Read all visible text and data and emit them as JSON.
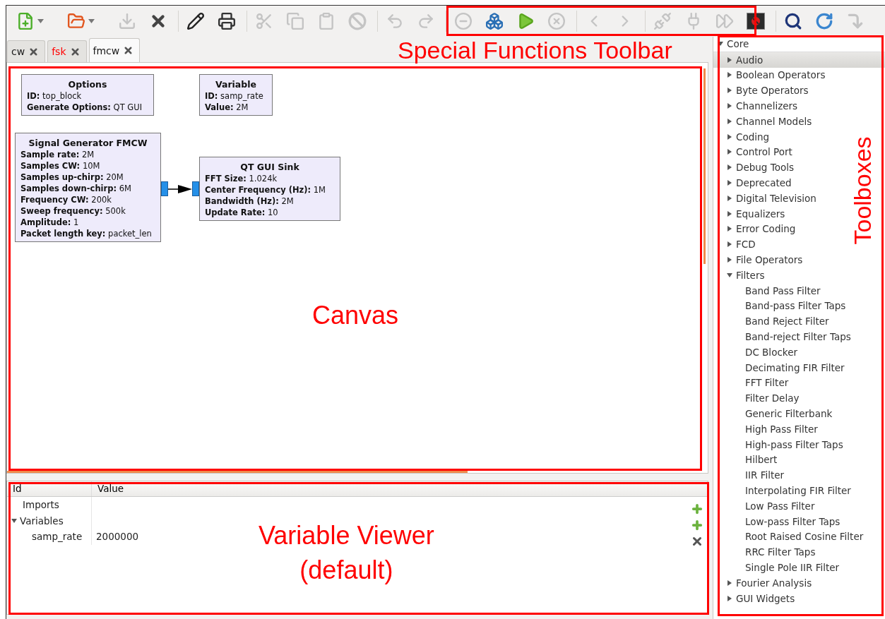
{
  "toolbar": [
    {
      "kind": "new",
      "disabled": false,
      "dropdown": true
    },
    {
      "kind": "open",
      "disabled": false,
      "dropdown": true
    },
    {
      "kind": "save",
      "disabled": true
    },
    {
      "kind": "close",
      "disabled": false
    },
    {
      "kind": "separator"
    },
    {
      "kind": "edit",
      "disabled": false
    },
    {
      "kind": "print",
      "disabled": false
    },
    {
      "kind": "separator"
    },
    {
      "kind": "cut",
      "disabled": true
    },
    {
      "kind": "copy",
      "disabled": true
    },
    {
      "kind": "paste",
      "disabled": true
    },
    {
      "kind": "delete",
      "disabled": true
    },
    {
      "kind": "separator"
    },
    {
      "kind": "undo",
      "disabled": true
    },
    {
      "kind": "redo",
      "disabled": true
    },
    {
      "kind": "separator"
    },
    {
      "kind": "disable",
      "disabled": true
    },
    {
      "kind": "generate",
      "disabled": false
    },
    {
      "kind": "execute",
      "disabled": false
    },
    {
      "kind": "stop",
      "disabled": true
    },
    {
      "kind": "separator"
    },
    {
      "kind": "back",
      "disabled": true
    },
    {
      "kind": "forward",
      "disabled": true
    },
    {
      "kind": "separator"
    },
    {
      "kind": "unplug",
      "disabled": true
    },
    {
      "kind": "plug",
      "disabled": true
    },
    {
      "kind": "fast-forward",
      "disabled": true
    },
    {
      "kind": "kill",
      "disabled": false
    },
    {
      "kind": "separator"
    },
    {
      "kind": "find",
      "disabled": false
    },
    {
      "kind": "reload",
      "disabled": false
    },
    {
      "kind": "rotate",
      "disabled": true
    }
  ],
  "tabs": [
    {
      "label": "cw",
      "selected": false,
      "color": "#1a1a1a"
    },
    {
      "label": "fsk",
      "selected": false,
      "color": "#ff0000"
    },
    {
      "label": "fmcw",
      "selected": true,
      "color": "#1a1a1a"
    }
  ],
  "canvas": {
    "blocks": [
      {
        "title": "Options",
        "params": [
          {
            "name": "ID:",
            "value": "top_block"
          },
          {
            "name": "Generate Options:",
            "value": "QT GUI"
          }
        ]
      },
      {
        "title": "Variable",
        "params": [
          {
            "name": "ID:",
            "value": "samp_rate"
          },
          {
            "name": "Value:",
            "value": "2M"
          }
        ]
      },
      {
        "title": "Signal Generator FMCW",
        "params": [
          {
            "name": "Sample rate:",
            "value": "2M"
          },
          {
            "name": "Samples CW:",
            "value": "10M"
          },
          {
            "name": "Samples up-chirp:",
            "value": "20M"
          },
          {
            "name": "Samples down-chirp:",
            "value": "6M"
          },
          {
            "name": "Frequency CW:",
            "value": "200k"
          },
          {
            "name": "Sweep frequency:",
            "value": "500k"
          },
          {
            "name": "Amplitude:",
            "value": "1"
          },
          {
            "name": "Packet length key:",
            "value": "packet_len"
          }
        ]
      },
      {
        "title": "QT GUI Sink",
        "params": [
          {
            "name": "FFT Size:",
            "value": "1.024k"
          },
          {
            "name": "Center Frequency (Hz):",
            "value": "1M"
          },
          {
            "name": "Bandwidth (Hz):",
            "value": "2M"
          },
          {
            "name": "Update Rate:",
            "value": "10"
          }
        ]
      }
    ]
  },
  "variable_viewer": {
    "columns": [
      "Id",
      "Value"
    ],
    "rows": [
      {
        "id": "Imports"
      },
      {
        "id": "Variables",
        "expanded": true,
        "children": [
          {
            "id": "samp_rate",
            "value": "2000000"
          }
        ]
      }
    ],
    "actions": [
      {
        "kind": "add"
      },
      {
        "kind": "add"
      },
      {
        "kind": "remove"
      }
    ]
  },
  "toolboxes": [
    {
      "label": "Core",
      "expanded": true,
      "selected": false,
      "children": [
        {
          "label": "Audio",
          "expanded": false,
          "selected": true
        },
        {
          "label": "Boolean Operators",
          "expanded": false,
          "selected": false
        },
        {
          "label": "Byte Operators",
          "expanded": false,
          "selected": false
        },
        {
          "label": "Channelizers",
          "expanded": false,
          "selected": false
        },
        {
          "label": "Channel Models",
          "expanded": false,
          "selected": false
        },
        {
          "label": "Coding",
          "expanded": false,
          "selected": false
        },
        {
          "label": "Control Port",
          "expanded": false,
          "selected": false
        },
        {
          "label": "Debug Tools",
          "expanded": false,
          "selected": false
        },
        {
          "label": "Deprecated",
          "expanded": false,
          "selected": false
        },
        {
          "label": "Digital Television",
          "expanded": false,
          "selected": false
        },
        {
          "label": "Equalizers",
          "expanded": false,
          "selected": false
        },
        {
          "label": "Error Coding",
          "expanded": false,
          "selected": false
        },
        {
          "label": "FCD",
          "expanded": false,
          "selected": false
        },
        {
          "label": "File Operators",
          "expanded": false,
          "selected": false
        },
        {
          "label": "Filters",
          "expanded": true,
          "selected": false,
          "children": [
            {
              "label": "Band Pass Filter",
              "selected": false
            },
            {
              "label": "Band-pass Filter Taps",
              "selected": false
            },
            {
              "label": "Band Reject Filter",
              "selected": false
            },
            {
              "label": "Band-reject Filter Taps",
              "selected": false
            },
            {
              "label": "DC Blocker",
              "selected": false
            },
            {
              "label": "Decimating FIR Filter",
              "selected": false
            },
            {
              "label": "FFT Filter",
              "selected": false
            },
            {
              "label": "Filter Delay",
              "selected": false
            },
            {
              "label": "Generic Filterbank",
              "selected": false
            },
            {
              "label": "High Pass Filter",
              "selected": false
            },
            {
              "label": "High-pass Filter Taps",
              "selected": false
            },
            {
              "label": "Hilbert",
              "selected": false
            },
            {
              "label": "IIR Filter",
              "selected": false
            },
            {
              "label": "Interpolating FIR Filter",
              "selected": false
            },
            {
              "label": "Low Pass Filter",
              "selected": false
            },
            {
              "label": "Low-pass Filter Taps",
              "selected": false
            },
            {
              "label": "Root Raised Cosine Filter",
              "selected": false
            },
            {
              "label": "RRC Filter Taps",
              "selected": false
            },
            {
              "label": "Single Pole IIR Filter",
              "selected": false
            }
          ]
        },
        {
          "label": "Fourier Analysis",
          "expanded": false,
          "selected": false
        },
        {
          "label": "GUI Widgets",
          "expanded": false,
          "selected": false
        }
      ]
    }
  ],
  "annotations": [
    {
      "kind": "toolbar",
      "lines": [
        "Special Functions Toolbar"
      ]
    },
    {
      "kind": "canvas",
      "lines": [
        "Canvas"
      ]
    },
    {
      "kind": "toolboxes",
      "lines": [
        "Toolboxes"
      ]
    },
    {
      "kind": "viewer",
      "lines": [
        "Variable Viewer",
        "(default)"
      ]
    }
  ]
}
